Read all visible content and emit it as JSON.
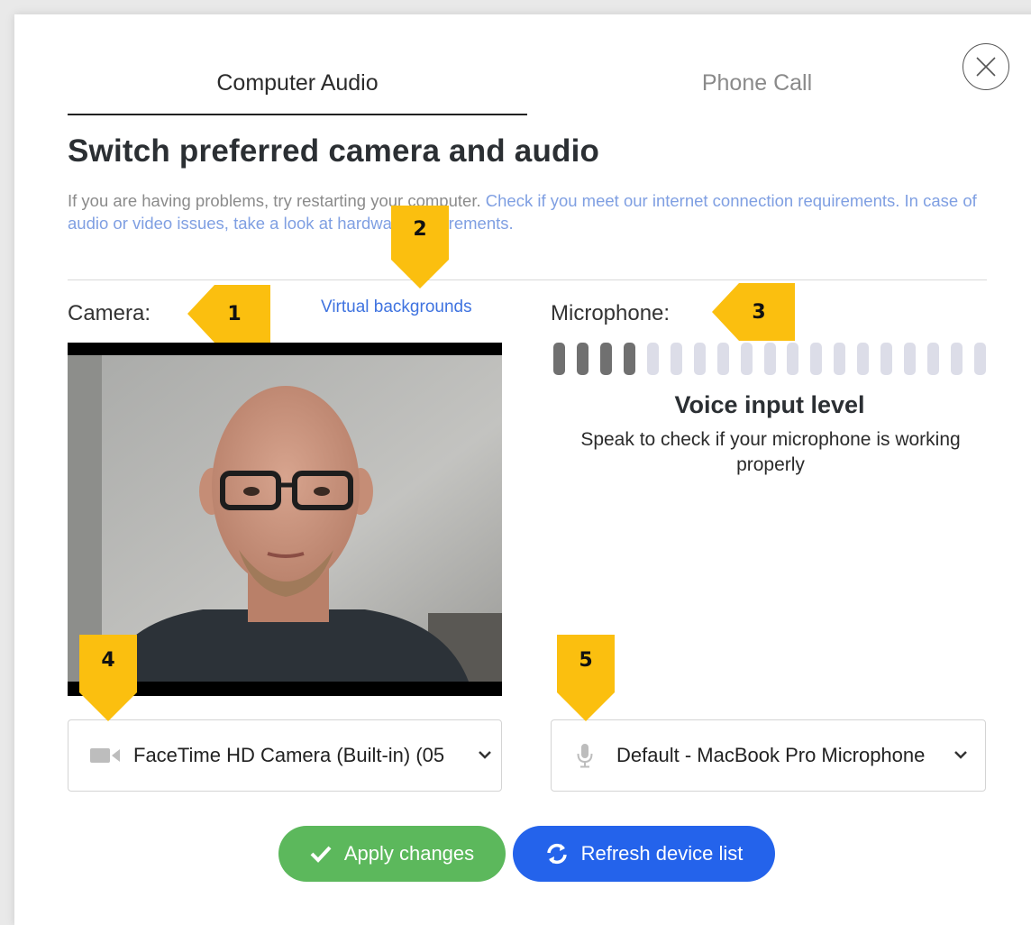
{
  "tabs": [
    {
      "label": "Computer Audio",
      "active": true
    },
    {
      "label": "Phone Call",
      "active": false
    }
  ],
  "title": "Switch preferred camera and audio",
  "description": {
    "plain": "If you are having problems, try restarting your computer. ",
    "link1": "Check if you meet our internet connection requirements.",
    "link2": "In case of audio or video issues, take a look at hardware requirements."
  },
  "camera": {
    "label": "Camera:",
    "virtual_backgrounds_link": "Virtual backgrounds",
    "device": "FaceTime HD Camera (Built-in) (05",
    "icon": "video-camera-icon"
  },
  "microphone": {
    "label": "Microphone:",
    "level": 4,
    "level_total": 19,
    "level_title": "Voice input level",
    "level_subtitle": "Speak to check if your microphone is working properly",
    "device": "Default - MacBook Pro Microphone",
    "icon": "microphone-icon"
  },
  "buttons": {
    "apply": "Apply changes",
    "refresh": "Refresh device list"
  },
  "callouts": [
    "1",
    "2",
    "3",
    "4",
    "5"
  ],
  "colors": {
    "apply": "#5cb85c",
    "refresh": "#2463eb",
    "link": "#3f73e0",
    "callout": "#fbbf0f",
    "meter_active": "#707070",
    "meter_inactive": "#dcdde8"
  }
}
